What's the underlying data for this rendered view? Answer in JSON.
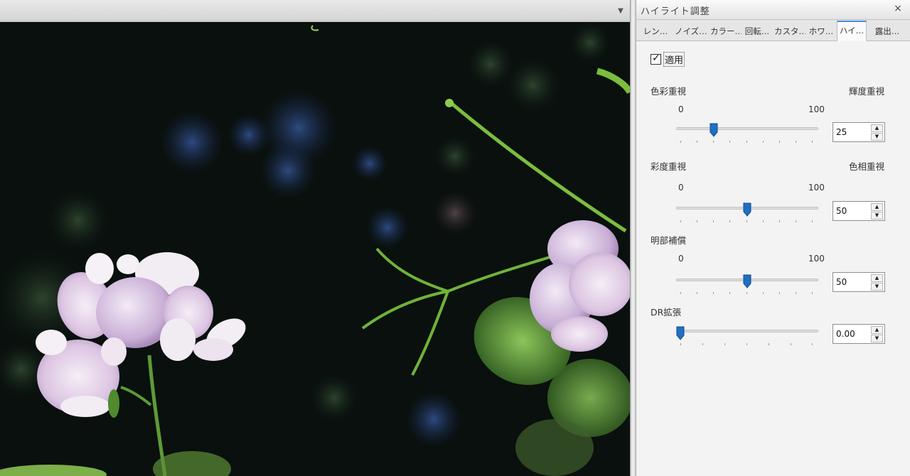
{
  "viewer": {
    "dropdown_icon": "chevron-down-icon"
  },
  "panel": {
    "title": "ハイライト調整",
    "close_glyph": "×",
    "tabs": [
      {
        "label": "レン…"
      },
      {
        "label": "ノイズ…"
      },
      {
        "label": "カラー…"
      },
      {
        "label": "回転…"
      },
      {
        "label": "カスタ…"
      },
      {
        "label": "ホワ…"
      },
      {
        "label": "ハイ…"
      },
      {
        "label": "露出…"
      }
    ],
    "active_tab": 6,
    "apply": {
      "label": "適用",
      "checked": true
    },
    "sliders": [
      {
        "name": "color",
        "left_label": "色彩重視",
        "right_label": "輝度重視",
        "min_label": "0",
        "max_label": "100",
        "value": 25,
        "display": "25"
      },
      {
        "name": "saturation",
        "left_label": "彩度重視",
        "right_label": "色相重視",
        "min_label": "0",
        "max_label": "100",
        "value": 50,
        "display": "50"
      },
      {
        "name": "bright",
        "left_label": "明部補償",
        "right_label": "",
        "min_label": "0",
        "max_label": "100",
        "value": 50,
        "display": "50"
      },
      {
        "name": "dr",
        "left_label": "DR拡張",
        "right_label": "",
        "min_label": "",
        "max_label": "",
        "value": 0,
        "display": "0.00"
      }
    ],
    "accent_color": "#1f6fc4"
  }
}
